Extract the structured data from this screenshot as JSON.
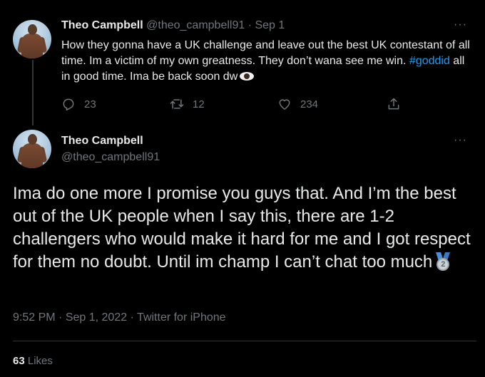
{
  "tweet_first": {
    "display_name": "Theo Campbell",
    "handle": "@theo_campbell91",
    "separator": " · ",
    "date": "Sep 1",
    "text_before_hashtag": "How they gonna have a UK challenge and leave out the best UK contestant of all time. Im a victim of my own greatness. They don’t wana see me win. ",
    "hashtag": "#goddid",
    "text_after_hashtag": " all in good time. Ima be back soon dw",
    "emoji": "eye",
    "more_label": "···",
    "replies": "23",
    "retweets": "12",
    "likes": "234",
    "icons": {
      "reply": "reply-icon",
      "retweet": "retweet-icon",
      "like": "heart-icon",
      "share": "share-icon"
    }
  },
  "tweet_main": {
    "display_name": "Theo Campbell",
    "handle": "@theo_campbell91",
    "more_label": "···",
    "text": "Ima do one more I promise you guys that. And I’m the best out of the UK people when I say this, there are 1-2 challengers who would make it hard for me and I got respect for them no doubt. Until im champ I can’t chat too much",
    "emoji": "second-place-medal",
    "medal_number": "2",
    "time": "9:52 PM",
    "meta_sep": " · ",
    "date": "Sep 1, 2022",
    "source": "Twitter for iPhone",
    "likes_count": "63",
    "likes_label": " Likes"
  },
  "colors": {
    "background": "#000000",
    "text": "#e7e9ea",
    "muted": "#71767b",
    "link": "#1d9bf0",
    "divider": "#2f3336"
  }
}
